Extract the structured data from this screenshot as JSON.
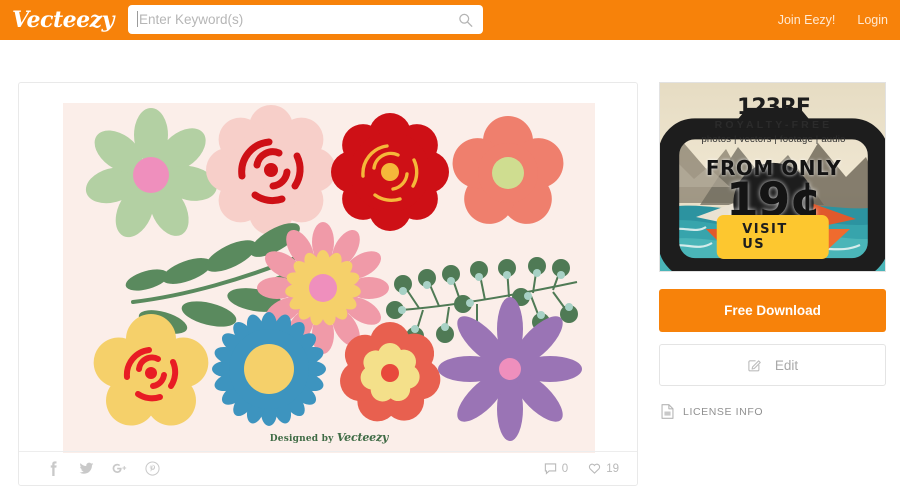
{
  "header": {
    "brand": "Vecteezy",
    "search": {
      "value": "",
      "placeholder": "Enter Keyword(s)",
      "icon": "search-icon"
    },
    "links": [
      {
        "label": "Join Eezy!",
        "name": "join-eezy-link"
      },
      {
        "label": "Login",
        "name": "login-link"
      }
    ]
  },
  "asset": {
    "watermark_prefix": "Designed by ",
    "watermark_brand": "Vecteezy",
    "background_color": "#fbeee9",
    "social": [
      {
        "name": "facebook-icon",
        "label": "f"
      },
      {
        "name": "twitter-icon",
        "label": "twitter"
      },
      {
        "name": "google-plus-icon",
        "label": "g+"
      },
      {
        "name": "pinterest-icon",
        "label": "pinterest"
      }
    ],
    "stats": {
      "comments_icon": "comment-icon",
      "comments_count": "0",
      "likes_icon": "heart-icon",
      "likes_count": "19"
    }
  },
  "ad": {
    "brand": "123RF",
    "logo_icon": "camera-icon",
    "royalty": "ROYALTY-FREE",
    "types": "photos | vectors | footage | audio",
    "from_only": "FROM ONLY",
    "price": "19¢",
    "cta": "VISIT US"
  },
  "sidebar": {
    "download_label": "Free Download",
    "edit_label": "Edit",
    "edit_icon": "pencil-edit-icon",
    "license_label": "LICENSE INFO",
    "license_icon": "document-icon"
  },
  "colors": {
    "brand_orange": "#f7820a",
    "ad_yellow": "#fdc72f",
    "artwork_bg": "#fbeee9",
    "flower_sage": "#b3d0a3",
    "flower_pink_center": "#ef8fbd",
    "flower_blush": "#f7cfc9",
    "flower_crimson": "#ce1016",
    "flower_salmon": "#ef7f6d",
    "flower_yellow": "#f5d06a",
    "flower_blue": "#3d94bf",
    "flower_purple": "#9a74b5",
    "leaf_green": "#5a8a5e",
    "berry_green": "#4f7a55"
  }
}
